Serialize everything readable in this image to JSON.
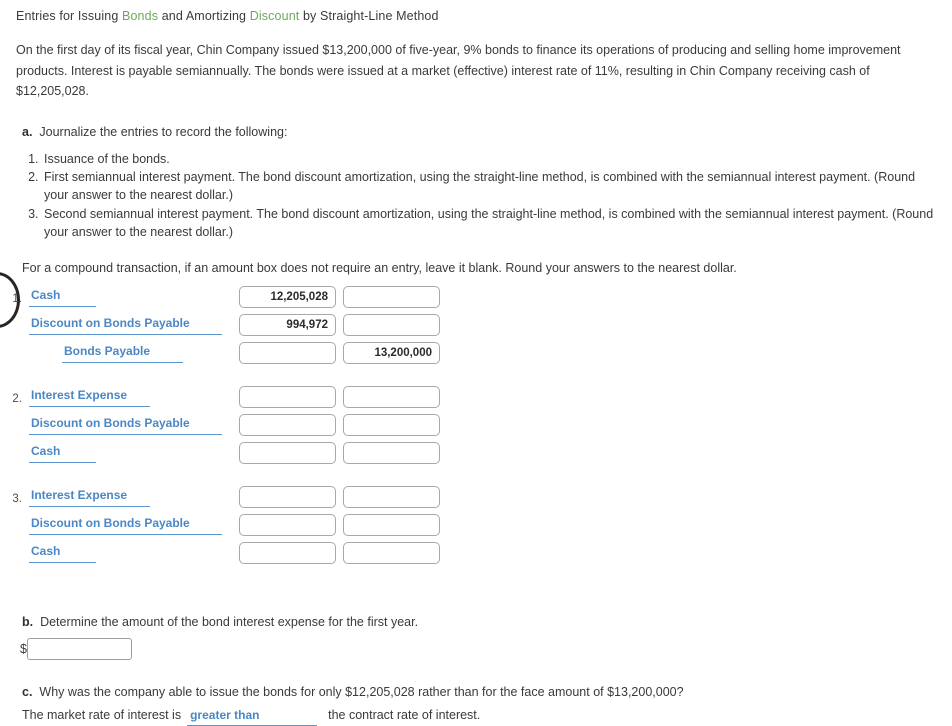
{
  "title": {
    "part1": "Entries for Issuing ",
    "link1": "Bonds",
    "part2": " and Amortizing ",
    "link2": "Discount",
    "part3": " by Straight-Line Method"
  },
  "intro": "On the first day of its fiscal year, Chin Company issued $13,200,000 of five-year, 9% bonds to finance its operations of producing and selling home improvement products. Interest is payable semiannually. The bonds were issued at a market (effective) interest rate of 11%, resulting in Chin Company receiving cash of $12,205,028.",
  "part_a": {
    "label": "a.",
    "text": "Journalize the entries to record the following:",
    "items": [
      "Issuance of the bonds.",
      "First semiannual interest payment. The bond discount amortization, using the straight-line method, is combined with the semiannual interest payment. (Round your answer to the nearest dollar.)",
      "Second semiannual interest payment. The bond discount amortization, using the straight-line method, is combined with the semiannual interest payment. (Round your answer to the nearest dollar.)"
    ]
  },
  "compound_note": "For a compound transaction, if an amount box does not require an entry, leave it blank. Round your answers to the nearest dollar.",
  "journal": {
    "entries": [
      {
        "number": "1.",
        "lines": [
          {
            "account": "Cash",
            "width": "w-short",
            "indent": false,
            "debit": "12,205,028",
            "credit": ""
          },
          {
            "account": "Discount on Bonds Payable",
            "width": "w-long",
            "indent": false,
            "debit": "994,972",
            "credit": ""
          },
          {
            "account": "Bonds Payable",
            "width": "w-mid",
            "indent": true,
            "debit": "",
            "credit": "13,200,000"
          }
        ]
      },
      {
        "number": "2.",
        "lines": [
          {
            "account": "Interest Expense",
            "width": "w-mid",
            "indent": false,
            "debit": "",
            "credit": ""
          },
          {
            "account": "Discount on Bonds Payable",
            "width": "w-long",
            "indent": false,
            "debit": "",
            "credit": ""
          },
          {
            "account": "Cash",
            "width": "w-short",
            "indent": false,
            "debit": "",
            "credit": ""
          }
        ]
      },
      {
        "number": "3.",
        "lines": [
          {
            "account": "Interest Expense",
            "width": "w-mid",
            "indent": false,
            "debit": "",
            "credit": ""
          },
          {
            "account": "Discount on Bonds Payable",
            "width": "w-long",
            "indent": false,
            "debit": "",
            "credit": ""
          },
          {
            "account": "Cash",
            "width": "w-short",
            "indent": false,
            "debit": "",
            "credit": ""
          }
        ]
      }
    ]
  },
  "part_b": {
    "label": "b.",
    "text": "Determine the amount of the bond interest expense for the first year.",
    "dollar": "$",
    "value": ""
  },
  "part_c": {
    "label": "c.",
    "text": "Why was the company able to issue the bonds for only $12,205,028 rather than for the face amount of $13,200,000?",
    "answer_prefix": "The market rate of interest is",
    "answer_selected": "greater than",
    "answer_suffix": "the contract rate of interest."
  },
  "colors": {
    "link_green": "#6aab5a",
    "link_blue": "#4a87c4",
    "text": "#3a3a3a"
  }
}
